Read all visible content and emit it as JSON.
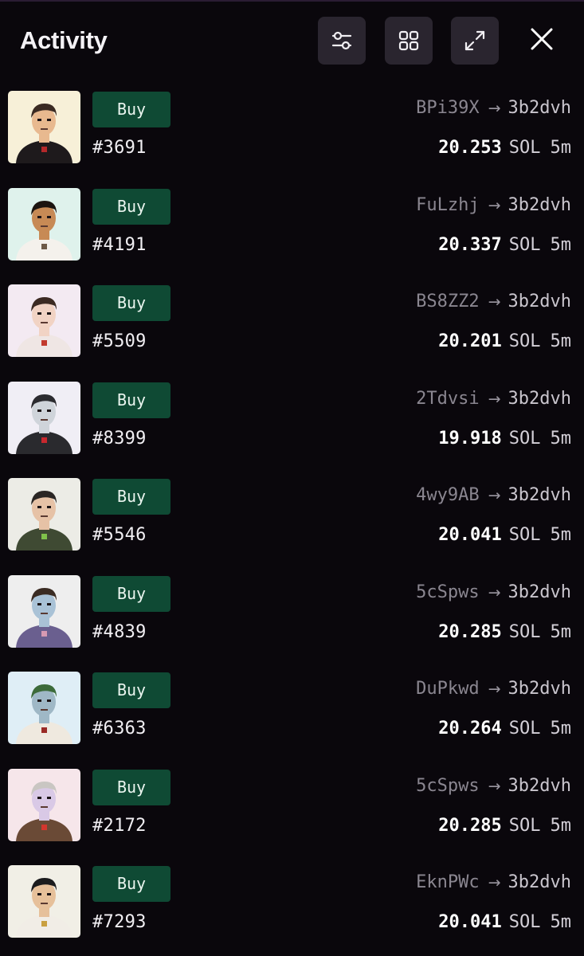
{
  "header": {
    "title": "Activity",
    "buttons": {
      "filter_icon": "sliders-icon",
      "grid_icon": "grid-icon",
      "expand_icon": "expand-icon",
      "close_icon": "close-icon"
    }
  },
  "colors": {
    "background": "#0a070c",
    "button_bg": "#2a252f",
    "buy_badge": "#0f4a34",
    "muted_text": "#8a8690"
  },
  "activity": [
    {
      "type": "Buy",
      "token": "#3691",
      "from": "BPi39X",
      "to": "3b2dvh",
      "price": "20.253",
      "currency": "SOL",
      "time": "5m"
    },
    {
      "type": "Buy",
      "token": "#4191",
      "from": "FuLzhj",
      "to": "3b2dvh",
      "price": "20.337",
      "currency": "SOL",
      "time": "5m"
    },
    {
      "type": "Buy",
      "token": "#5509",
      "from": "BS8ZZ2",
      "to": "3b2dvh",
      "price": "20.201",
      "currency": "SOL",
      "time": "5m"
    },
    {
      "type": "Buy",
      "token": "#8399",
      "from": "2Tdvsi",
      "to": "3b2dvh",
      "price": "19.918",
      "currency": "SOL",
      "time": "5m"
    },
    {
      "type": "Buy",
      "token": "#5546",
      "from": "4wy9AB",
      "to": "3b2dvh",
      "price": "20.041",
      "currency": "SOL",
      "time": "5m"
    },
    {
      "type": "Buy",
      "token": "#4839",
      "from": "5cSpws",
      "to": "3b2dvh",
      "price": "20.285",
      "currency": "SOL",
      "time": "5m"
    },
    {
      "type": "Buy",
      "token": "#6363",
      "from": "DuPkwd",
      "to": "3b2dvh",
      "price": "20.264",
      "currency": "SOL",
      "time": "5m"
    },
    {
      "type": "Buy",
      "token": "#2172",
      "from": "5cSpws",
      "to": "3b2dvh",
      "price": "20.285",
      "currency": "SOL",
      "time": "5m"
    },
    {
      "type": "Buy",
      "token": "#7293",
      "from": "EknPWc",
      "to": "3b2dvh",
      "price": "20.041",
      "currency": "SOL",
      "time": "5m"
    }
  ],
  "avatars": [
    {
      "bg": "#f7f0d8",
      "skin": "#e8b98f",
      "hair": "#3a2a22",
      "shirt": "#1e1a1c",
      "accent": "#b4282a"
    },
    {
      "bg": "#dff2ec",
      "skin": "#c78a55",
      "hair": "#1c1410",
      "shirt": "#f4f1ec",
      "accent": "#6d5a48"
    },
    {
      "bg": "#f3eaf2",
      "skin": "#f1d3c4",
      "hair": "#3b2a22",
      "shirt": "#efe6e4",
      "accent": "#c23a2e"
    },
    {
      "bg": "#f0eef5",
      "skin": "#cfd4da",
      "hair": "#2b2b2f",
      "shirt": "#2a2a2e",
      "accent": "#c8282e"
    },
    {
      "bg": "#ecece6",
      "skin": "#e6c2a6",
      "hair": "#2a2624",
      "shirt": "#3f4a33",
      "accent": "#7fc24a"
    },
    {
      "bg": "#eeeeee",
      "skin": "#a9c2d6",
      "hair": "#3a2b22",
      "shirt": "#6a5f8f",
      "accent": "#d79ab2"
    },
    {
      "bg": "#dfeef6",
      "skin": "#9fb8c6",
      "hair": "#3c6b3a",
      "shirt": "#efe9df",
      "accent": "#9a2a26"
    },
    {
      "bg": "#f6e6ea",
      "skin": "#d9c9e6",
      "hair": "#c9c6c2",
      "shirt": "#6a4a36",
      "accent": "#d2362e"
    },
    {
      "bg": "#f1efe6",
      "skin": "#e6c09a",
      "hair": "#1b1b1d",
      "shirt": "#f1ede6",
      "accent": "#c9a040"
    }
  ]
}
